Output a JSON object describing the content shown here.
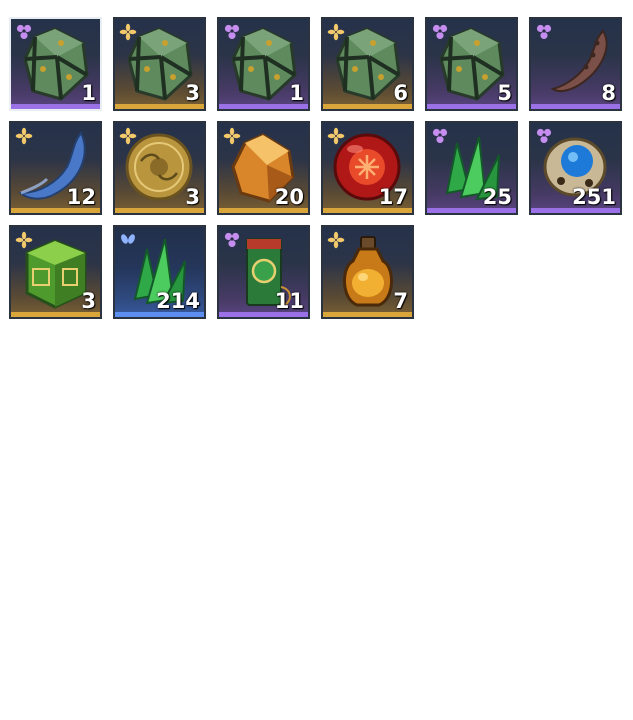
{
  "inventory": {
    "items": [
      {
        "name": "jade-dice-icon",
        "rarity": "purple",
        "count": "1",
        "selected": true
      },
      {
        "name": "jade-dice-icon",
        "rarity": "gold",
        "count": "3"
      },
      {
        "name": "jade-dice-icon",
        "rarity": "purple",
        "count": "1"
      },
      {
        "name": "jade-dice-icon",
        "rarity": "gold",
        "count": "6"
      },
      {
        "name": "jade-dice-icon",
        "rarity": "purple",
        "count": "5"
      },
      {
        "name": "bone-claw-icon",
        "rarity": "purple",
        "count": "8"
      },
      {
        "name": "blue-fang-icon",
        "rarity": "gold",
        "count": "12"
      },
      {
        "name": "gold-coin-icon",
        "rarity": "gold",
        "count": "3"
      },
      {
        "name": "amber-gem-icon",
        "rarity": "gold",
        "count": "20"
      },
      {
        "name": "red-orb-icon",
        "rarity": "gold",
        "count": "17"
      },
      {
        "name": "green-crystal-icon",
        "rarity": "purple",
        "count": "25"
      },
      {
        "name": "blue-skull-icon",
        "rarity": "purple",
        "count": "251"
      },
      {
        "name": "jade-cube-icon",
        "rarity": "gold",
        "count": "3"
      },
      {
        "name": "green-crystal-icon",
        "rarity": "blue",
        "count": "214"
      },
      {
        "name": "talisman-icon",
        "rarity": "purple",
        "count": "11"
      },
      {
        "name": "potion-bottle-icon",
        "rarity": "gold",
        "count": "7"
      }
    ]
  },
  "colors": {
    "purple": "#9b71e8",
    "gold": "#d9a63b",
    "blue": "#5b8ef0"
  }
}
